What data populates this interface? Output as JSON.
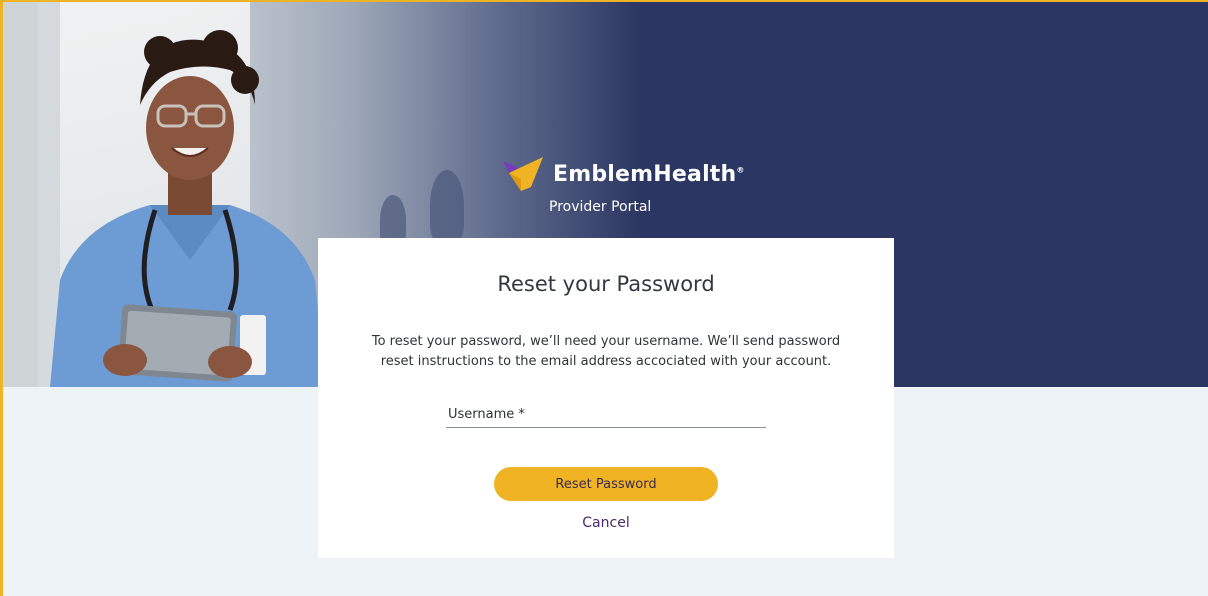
{
  "brand": {
    "name": "EmblemHealth",
    "registered_mark": "®",
    "subtitle": "Provider Portal",
    "colors": {
      "navy": "#2b3762",
      "gold": "#f0b323",
      "purple": "#4a2a6a",
      "page_bg": "#eef3f7"
    }
  },
  "hero": {
    "image": "nurse-with-tablet-photo"
  },
  "reset_card": {
    "title": "Reset your Password",
    "description": "To reset your password, we’ll need your username. We’ll send password reset instructions to the email address accociated with your account.",
    "username_field": {
      "placeholder": "Username *",
      "value": ""
    },
    "submit_label": "Reset Password",
    "cancel_label": "Cancel"
  }
}
